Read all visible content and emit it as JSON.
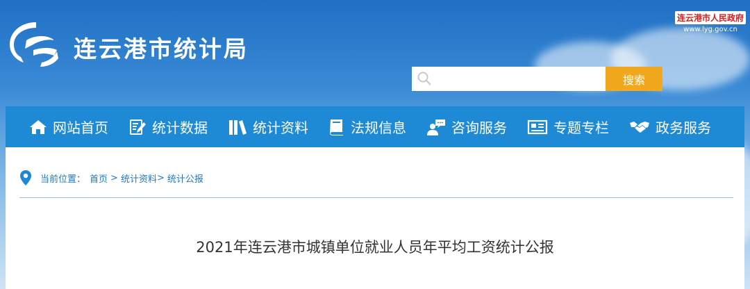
{
  "site": {
    "title": "连云港市统计局"
  },
  "gov_badge": {
    "name": "连云港市人民政府",
    "url": "www.lyg.gov.cn"
  },
  "search": {
    "placeholder": "",
    "value": "",
    "button_label": "搜索"
  },
  "nav": {
    "items": [
      {
        "label": "网站首页",
        "icon": "home-icon"
      },
      {
        "label": "统计数据",
        "icon": "data-edit-icon"
      },
      {
        "label": "统计资料",
        "icon": "books-icon"
      },
      {
        "label": "法规信息",
        "icon": "book-icon"
      },
      {
        "label": "咨询服务",
        "icon": "consult-icon"
      },
      {
        "label": "专题专栏",
        "icon": "newspaper-icon"
      },
      {
        "label": "政务服务",
        "icon": "handshake-icon"
      }
    ]
  },
  "breadcrumb": {
    "prefix": "当前位置：",
    "items": [
      "首页",
      "统计资料",
      "统计公报"
    ],
    "separator": ">"
  },
  "article": {
    "title": "2021年连云港市城镇单位就业人员年平均工资统计公报"
  },
  "colors": {
    "nav_bg": "#1e8ad6",
    "search_button": "#f2a81d",
    "breadcrumb_text": "#1e78c8",
    "gov_badge_text": "#d32020"
  }
}
